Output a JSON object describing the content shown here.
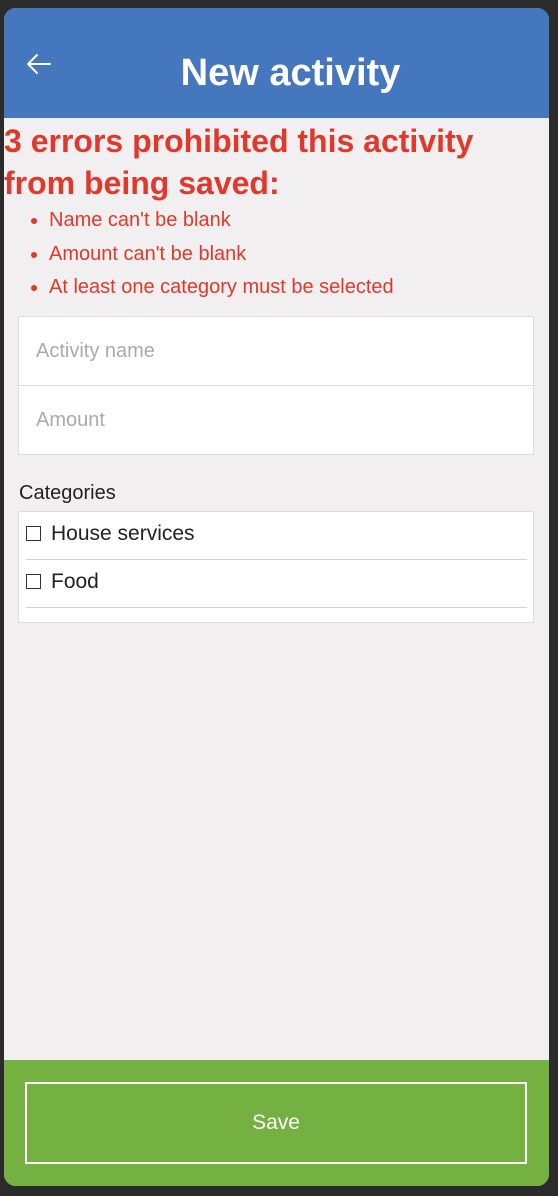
{
  "header": {
    "title": "New activity",
    "back_icon": "arrow-left-icon"
  },
  "errors": {
    "heading": "3 errors prohibited this activity from being saved:",
    "items": [
      "Name can't be blank",
      "Amount can't be blank",
      "At least one category must be selected"
    ]
  },
  "form": {
    "name_placeholder": "Activity name",
    "name_value": "",
    "amount_placeholder": "Amount",
    "amount_value": ""
  },
  "categories": {
    "label": "Categories",
    "items": [
      {
        "label": "House services",
        "checked": false
      },
      {
        "label": "Food",
        "checked": false
      }
    ]
  },
  "footer": {
    "save_label": "Save"
  },
  "colors": {
    "header": "#4577be",
    "error": "#e2382b",
    "footer": "#74b140",
    "background": "#f1eff0"
  }
}
